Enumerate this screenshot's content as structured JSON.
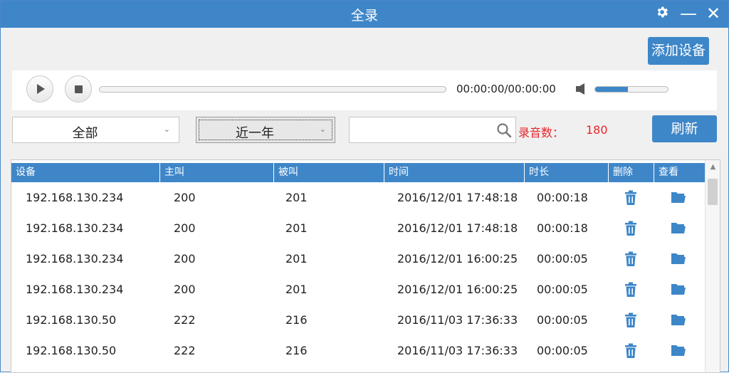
{
  "window": {
    "title": "全录"
  },
  "titlebar": {
    "icons": [
      "gear-icon",
      "minimize-icon",
      "close-icon"
    ],
    "minimize_glyph": "—",
    "close_glyph": "✕"
  },
  "toolbar": {
    "add_device_label": "添加设备"
  },
  "player": {
    "time": "00:00:00/00:00:00",
    "progress": 0,
    "volume": 0.45
  },
  "filters": {
    "device_filter": "全部",
    "range_filter": "近一年",
    "search_value": "",
    "record_count_label": "录音数：",
    "record_count": "180",
    "refresh_label": "刷新"
  },
  "table": {
    "columns": [
      "设备",
      "主叫",
      "被叫",
      "时间",
      "时长",
      "删除",
      "查看"
    ],
    "rows": [
      {
        "device": "192.168.130.234",
        "caller": "200",
        "callee": "201",
        "time": "2016/12/01 17:48:18",
        "duration": "00:00:18"
      },
      {
        "device": "192.168.130.234",
        "caller": "200",
        "callee": "201",
        "time": "2016/12/01 17:48:18",
        "duration": "00:00:18"
      },
      {
        "device": "192.168.130.234",
        "caller": "200",
        "callee": "201",
        "time": "2016/12/01 16:00:25",
        "duration": "00:00:05"
      },
      {
        "device": "192.168.130.234",
        "caller": "200",
        "callee": "201",
        "time": "2016/12/01 16:00:25",
        "duration": "00:00:05"
      },
      {
        "device": "192.168.130.50",
        "caller": "222",
        "callee": "216",
        "time": "2016/11/03 17:36:33",
        "duration": "00:00:05"
      },
      {
        "device": "192.168.130.50",
        "caller": "222",
        "callee": "216",
        "time": "2016/11/03 17:36:33",
        "duration": "00:00:05"
      }
    ]
  },
  "colors": {
    "accent": "#3f86c9",
    "count": "#e8262d",
    "icon": "#3d86c8"
  }
}
